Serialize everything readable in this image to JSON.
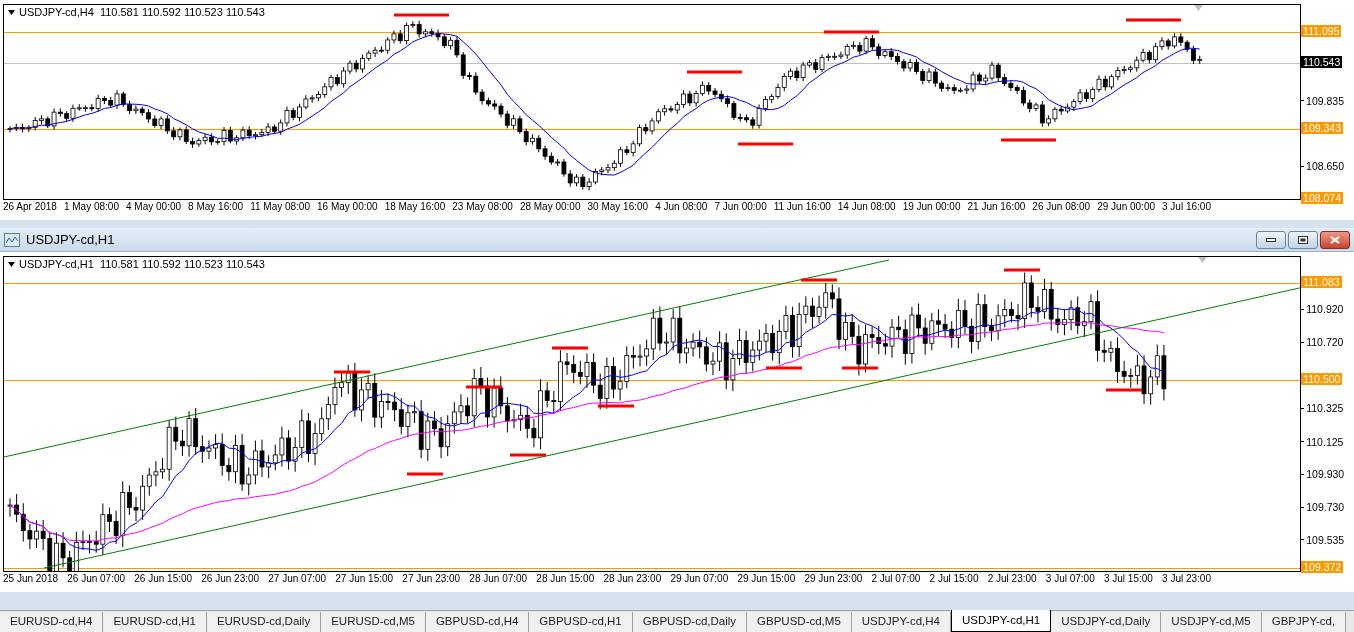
{
  "charts": [
    {
      "header": "USDJPY-cd,H4  110.581 110.592 110.523 110.543",
      "price_labels": [
        {
          "text": "111.095",
          "kind": "marker"
        },
        {
          "text": "110.543",
          "kind": "current"
        },
        {
          "text": "109.835",
          "kind": "tick"
        },
        {
          "text": "109.343",
          "kind": "marker"
        },
        {
          "text": "108.650",
          "kind": "tick"
        },
        {
          "text": "108.074",
          "kind": "marker"
        }
      ],
      "time_labels": [
        "26 Apr 2018",
        "1 May 08:00",
        "4 May 00:00",
        "8 May 16:00",
        "11 May 08:00",
        "16 May 00:00",
        "18 May 16:00",
        "23 May 08:00",
        "28 May 00:00",
        "30 May 16:00",
        "4 Jun 08:00",
        "7 Jun 00:00",
        "11 Jun 16:00",
        "14 Jun 08:00",
        "19 Jun 00:00",
        "21 Jun 16:00",
        "26 Jun 08:00",
        "29 Jun 00:00",
        "3 Jul 16:00"
      ]
    },
    {
      "window_title": "USDJPY-cd,H1",
      "header": "USDJPY-cd,H1  110.581 110.592 110.523 110.543",
      "price_labels": [
        {
          "text": "111.083",
          "kind": "marker"
        },
        {
          "text": "110.920",
          "kind": "tick"
        },
        {
          "text": "110.720",
          "kind": "tick"
        },
        {
          "text": "110.500",
          "kind": "marker"
        },
        {
          "text": "110.325",
          "kind": "tick"
        },
        {
          "text": "110.125",
          "kind": "tick"
        },
        {
          "text": "109.930",
          "kind": "tick"
        },
        {
          "text": "109.730",
          "kind": "tick"
        },
        {
          "text": "109.535",
          "kind": "tick"
        },
        {
          "text": "109.372",
          "kind": "marker"
        }
      ],
      "time_labels": [
        "25 Jun 2018",
        "26 Jun 07:00",
        "26 Jun 15:00",
        "26 Jun 23:00",
        "27 Jun 07:00",
        "27 Jun 15:00",
        "27 Jun 23:00",
        "28 Jun 07:00",
        "28 Jun 15:00",
        "28 Jun 23:00",
        "29 Jun 07:00",
        "29 Jun 15:00",
        "29 Jun 23:00",
        "2 Jul 07:00",
        "2 Jul 15:00",
        "2 Jul 23:00",
        "3 Jul 07:00",
        "3 Jul 15:00",
        "3 Jul 23:00"
      ]
    }
  ],
  "tabs": [
    {
      "label": "EURUSD-cd,H4",
      "selected": false
    },
    {
      "label": "EURUSD-cd,H1",
      "selected": false
    },
    {
      "label": "EURUSD-cd,Daily",
      "selected": false
    },
    {
      "label": "EURUSD-cd,M5",
      "selected": false
    },
    {
      "label": "GBPUSD-cd,H4",
      "selected": false
    },
    {
      "label": "GBPUSD-cd,H1",
      "selected": false
    },
    {
      "label": "GBPUSD-cd,Daily",
      "selected": false
    },
    {
      "label": "GBPUSD-cd,M5",
      "selected": false
    },
    {
      "label": "USDJPY-cd,H4",
      "selected": false
    },
    {
      "label": "USDJPY-cd,H1",
      "selected": true
    },
    {
      "label": "USDJPY-cd,Daily",
      "selected": false
    },
    {
      "label": "USDJPY-cd,M5",
      "selected": false
    },
    {
      "label": "GBPJPY-cd,",
      "selected": false
    }
  ]
}
